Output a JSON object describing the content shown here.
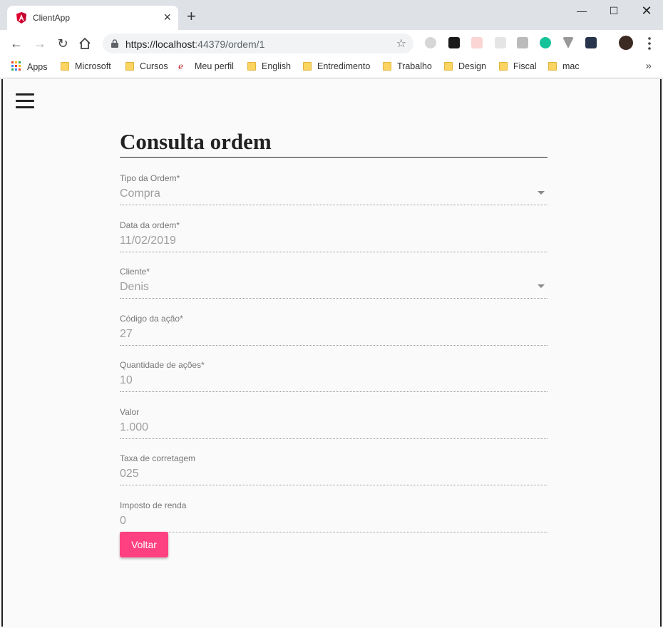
{
  "browser": {
    "tab_title": "ClientApp",
    "new_tab_symbol": "+",
    "url_scheme_host": "https://localhost",
    "url_port_path": ":44379/ordem/1",
    "bookmarks": [
      {
        "label": "Apps",
        "kind": "apps"
      },
      {
        "label": "Microsoft",
        "kind": "folder"
      },
      {
        "label": "Cursos",
        "kind": "folder"
      },
      {
        "label": "Meu perfil",
        "kind": "site"
      },
      {
        "label": "English",
        "kind": "folder"
      },
      {
        "label": "Entredimento",
        "kind": "folder"
      },
      {
        "label": "Trabalho",
        "kind": "folder"
      },
      {
        "label": "Design",
        "kind": "folder"
      },
      {
        "label": "Fiscal",
        "kind": "folder"
      },
      {
        "label": "mac",
        "kind": "folder"
      }
    ]
  },
  "page": {
    "title": "Consulta ordem",
    "fields": [
      {
        "label": "Tipo da Ordem*",
        "value": "Compra",
        "select": true
      },
      {
        "label": "Data da ordem*",
        "value": "11/02/2019",
        "select": false
      },
      {
        "label": "Cliente*",
        "value": "Denis",
        "select": true
      },
      {
        "label": "Código da ação*",
        "value": "27",
        "select": false
      },
      {
        "label": "Quantidade de ações*",
        "value": "10",
        "select": false
      },
      {
        "label": "Valor",
        "value": "1.000",
        "select": false
      },
      {
        "label": "Taxa de corretagem",
        "value": "025",
        "select": false
      },
      {
        "label": "Imposto de renda",
        "value": "0",
        "select": false
      }
    ],
    "back_button": "Voltar"
  },
  "colors": {
    "accent": "#ff4081",
    "angular_red": "#dd0031"
  }
}
